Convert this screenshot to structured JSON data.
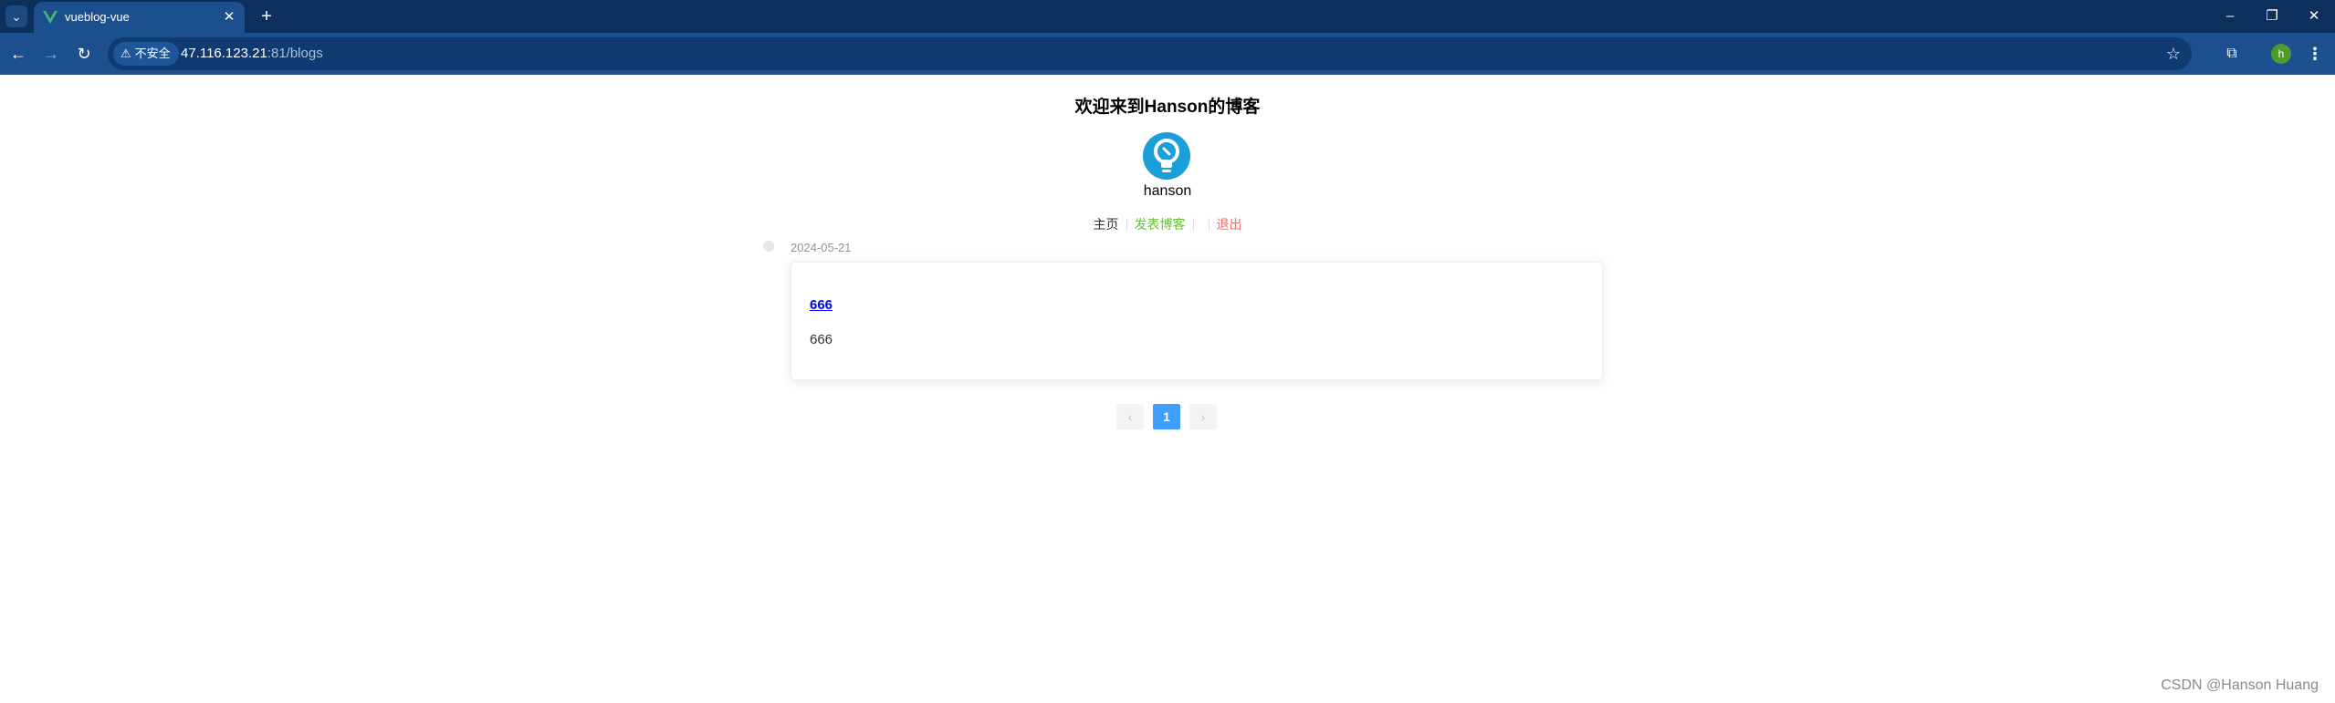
{
  "browser": {
    "tab_title": "vueblog-vue",
    "tab_close": "✕",
    "new_tab": "+",
    "security_label": "不安全",
    "url_host": "47.116.123.21",
    "url_rest": ":81/blogs",
    "profile_initial": "h",
    "icons": {
      "tab_search": "chevron-down-icon",
      "back": "arrow-left-icon",
      "forward": "arrow-right-icon",
      "reload": "reload-icon",
      "warning": "warning-icon",
      "bookmark": "star-icon",
      "extensions": "puzzle-icon",
      "menu": "kebab-menu-icon"
    },
    "colors": {
      "tabbar": "#0c2f5c",
      "toolbar": "#1c4f8e",
      "favicon": "#41b883"
    }
  },
  "page": {
    "site_title": "欢迎来到Hanson的博客",
    "username": "hanson",
    "nav": {
      "home": "主页",
      "post": "发表博客",
      "logout": "退出"
    },
    "colors": {
      "post_link": "#67c23a",
      "logout_link": "#f56c6c",
      "page_active": "#409eff",
      "avatar": "#1a9fd9"
    }
  },
  "blogs": [
    {
      "timestamp": "2024-05-21",
      "title": "666",
      "description": "666"
    }
  ],
  "pagination": {
    "prev": "‹",
    "current": "1",
    "next": "›"
  },
  "watermark": "CSDN @Hanson Huang"
}
